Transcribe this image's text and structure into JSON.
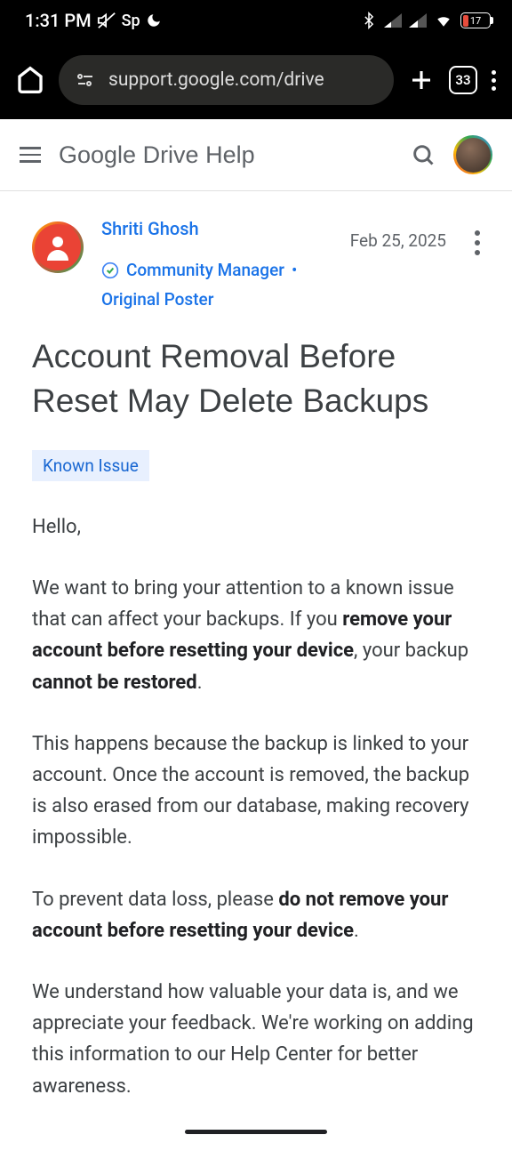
{
  "status_bar": {
    "time": "1:31 PM",
    "sp_label": "Sp",
    "battery_text": "17"
  },
  "browser": {
    "url": "support.google.com/drive",
    "tab_count": "33"
  },
  "header": {
    "title": "Google Drive Help"
  },
  "post": {
    "author": "Shriti Ghosh",
    "date": "Feb 25, 2025",
    "role": "Community Manager",
    "poster_tag": "Original Poster",
    "title": "Account Removal Before Reset May Delete Backups",
    "tag": "Known Issue",
    "greeting": "Hello,",
    "p1_a": "We want to bring your attention to a known issue that can affect your backups. If you ",
    "p1_b": "remove your account before resetting your device",
    "p1_c": ", your backup ",
    "p1_d": "cannot be restored",
    "p1_e": ".",
    "p2": "This happens because the backup is linked to your account. Once the account is removed, the backup is also erased from our database, making recovery impossible.",
    "p3_a": "To prevent data loss, please ",
    "p3_b": "do not remove your account before resetting your device",
    "p3_c": ".",
    "p4": "We understand how valuable your data is, and we appreciate your feedback. We're working on adding this information to our Help Center for better awareness."
  }
}
